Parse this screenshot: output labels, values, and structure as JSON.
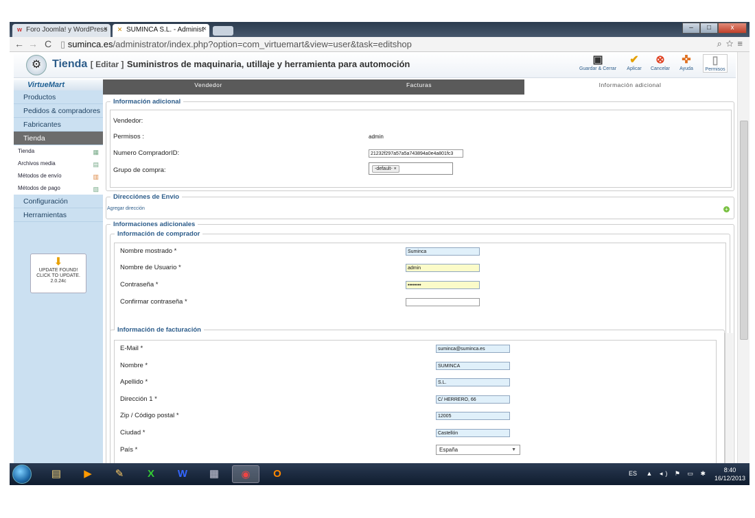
{
  "browser": {
    "tabs": [
      {
        "favicon": "w",
        "label": "Foro Joomla! y WordPress",
        "close": "×"
      },
      {
        "favicon": "✕",
        "label": "SUMINCA S.L. - Administ",
        "close": "×"
      }
    ],
    "url_host": "suminca.es",
    "url_path": "/administrator/index.php?option=com_virtuemart&view=user&task=editshop",
    "window_controls": [
      "–",
      "□",
      "x"
    ]
  },
  "toolbar": {
    "title_main": "Tienda",
    "title_edit": "[ Editar ]",
    "title_shop": "Suministros de maquinaria, utillaje y herramienta para automoción",
    "buttons": [
      {
        "label": "Guardar & Cerrar",
        "icon": "save-icon"
      },
      {
        "label": "Aplicar",
        "icon": "check-icon"
      },
      {
        "label": "Cancelar",
        "icon": "cancel-icon"
      },
      {
        "label": "Ayuda",
        "icon": "help-icon"
      },
      {
        "label": "Permisos",
        "icon": "lock-icon"
      }
    ]
  },
  "sidebar": {
    "logo": "VirtueMart",
    "top_items": [
      "Productos",
      "Pedidos & compradores",
      "Fabricantes",
      "Tienda"
    ],
    "sub_items": [
      "Tienda",
      "Archivos media",
      "Métodos de envío",
      "Métodos de pago"
    ],
    "bottom_items": [
      "Configuración",
      "Herramientas"
    ],
    "update_box": {
      "line1": "UPDATE FOUND!",
      "line2": "CLICK TO UPDATE.",
      "version": "2.0.24c"
    }
  },
  "content_tabs": [
    "Vendedor",
    "Facturas",
    "Información adicional"
  ],
  "info_adicional": {
    "legend": "Información adicional",
    "vendedor_label": "Vendedor:",
    "permisos_label": "Permisos :",
    "permisos_value": "admin",
    "comprador_id_label": "Numero CompradorID:",
    "comprador_id_value": "21232f297a57a5a743894a0e4a801fc3",
    "grupo_label": "Grupo de compra:",
    "grupo_tag": "-default-",
    "grupo_tag_remove": "×"
  },
  "envio": {
    "legend": "Direcciónes de Envio",
    "add_link": "Agregar dirección",
    "plus": "+"
  },
  "info_comprador": {
    "outer_legend": "Informaciones adicionales",
    "legend": "Información de comprador",
    "fields": [
      {
        "label": "Nombre mostrado *",
        "value": "Suminca"
      },
      {
        "label": "Nombre de Usuario *",
        "value": "admin"
      },
      {
        "label": "Contraseña *",
        "value": "••••••••"
      },
      {
        "label": "Confirmar contraseña *",
        "value": ""
      }
    ]
  },
  "info_facturacion": {
    "legend": "Información de facturación",
    "fields": [
      {
        "label": "E-Mail *",
        "value": "suminca@suminca.es"
      },
      {
        "label": "Nombre *",
        "value": "SUMINCA"
      },
      {
        "label": "Apellido *",
        "value": "S.L."
      },
      {
        "label": "Dirección 1 *",
        "value": "C/ HERRERO, 66"
      },
      {
        "label": "Zip / Código postal *",
        "value": "12005"
      },
      {
        "label": "Ciudad *",
        "value": "Castellón"
      },
      {
        "label": "País *",
        "value": "España"
      }
    ]
  },
  "taskbar": {
    "lang": "ES",
    "time": "8:40",
    "date": "16/12/2013"
  }
}
